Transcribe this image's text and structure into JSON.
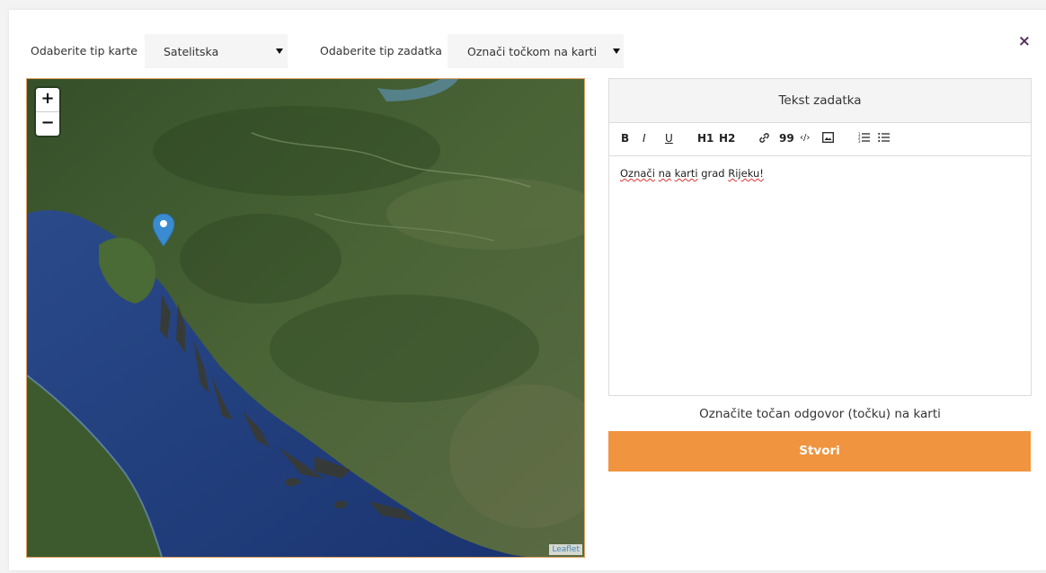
{
  "header": {
    "map_type_label": "Odaberite tip karte",
    "map_type_value": "Satelitska",
    "task_type_label": "Odaberite tip zadatka",
    "task_type_value": "Označi točkom na karti",
    "close_symbol": "×"
  },
  "map": {
    "zoom_in": "+",
    "zoom_out": "−",
    "attribution": "Leaflet",
    "marker_icon": "map-marker-icon"
  },
  "editor": {
    "title": "Tekst zadatka",
    "toolbar": {
      "bold": "B",
      "italic": "I",
      "underline": "U",
      "h1": "H1",
      "h2": "H2",
      "link": "link-icon",
      "quote": "99",
      "code": "‹/›",
      "image": "image-icon",
      "ordered_list": "ordered-list-icon",
      "bullet_list": "bullet-list-icon"
    },
    "content_words": [
      "Označi",
      "na",
      "karti",
      "grad",
      "Rijeku!"
    ]
  },
  "hint": "Označite točan odgovor (točku) na karti",
  "submit_label": "Stvori",
  "colors": {
    "accent": "#f0943f",
    "close": "#57305f",
    "sea": "#213f7c",
    "land": "#3f5a30"
  }
}
